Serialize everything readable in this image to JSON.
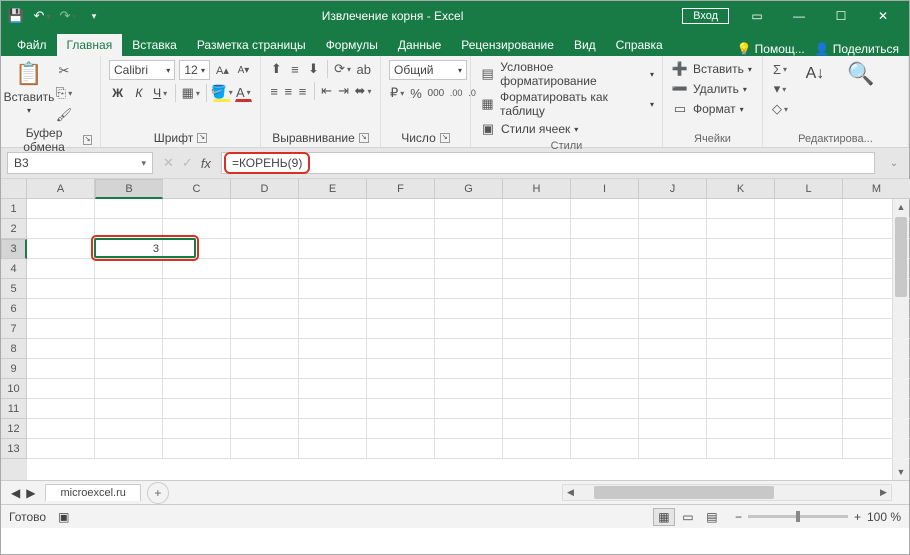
{
  "titlebar": {
    "title": "Извлечение корня  -  Excel",
    "signin": "Вход"
  },
  "tabs": {
    "items": [
      "Файл",
      "Главная",
      "Вставка",
      "Разметка страницы",
      "Формулы",
      "Данные",
      "Рецензирование",
      "Вид",
      "Справка"
    ],
    "active": 1,
    "help": "Помощ...",
    "share": "Поделиться"
  },
  "ribbon": {
    "clipboard": {
      "paste": "Вставить",
      "label": "Буфер обмена"
    },
    "font": {
      "label": "Шрифт",
      "name": "Calibri",
      "size": "12",
      "bold": "Ж",
      "italic": "К",
      "underline": "Ч"
    },
    "align": {
      "label": "Выравнивание"
    },
    "number": {
      "label": "Число",
      "fmt": "Общий"
    },
    "styles": {
      "label": "Стили",
      "cond": "Условное форматирование",
      "table": "Форматировать как таблицу",
      "cell": "Стили ячеек"
    },
    "cells": {
      "label": "Ячейки",
      "insert": "Вставить",
      "delete": "Удалить",
      "format": "Формат"
    },
    "editing": {
      "label": "Редактирова..."
    }
  },
  "formulaBar": {
    "nameBox": "B3",
    "formula": "=КОРЕНЬ(9)"
  },
  "grid": {
    "cols": [
      "A",
      "B",
      "C",
      "D",
      "E",
      "F",
      "G",
      "H",
      "I",
      "J",
      "K",
      "L",
      "M"
    ],
    "rows": [
      "1",
      "2",
      "3",
      "4",
      "5",
      "6",
      "7",
      "8",
      "9",
      "10",
      "11",
      "12",
      "13"
    ],
    "selCol": 1,
    "selRow": 2,
    "cells": {
      "B3": "3"
    }
  },
  "sheet": {
    "name": "microexcel.ru"
  },
  "status": {
    "ready": "Готово",
    "zoom": "100 %"
  }
}
